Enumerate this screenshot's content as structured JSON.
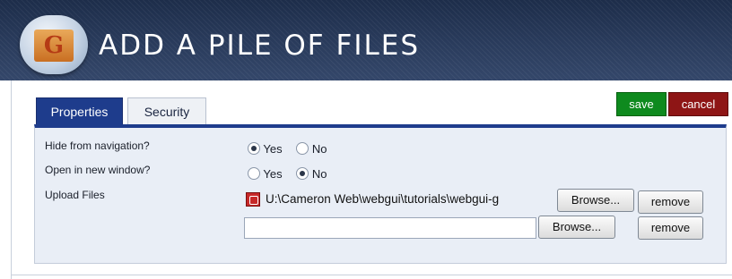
{
  "header": {
    "title": "ADD A PILE OF FILES",
    "logo_letter": "G"
  },
  "tabs": [
    {
      "label": "Properties",
      "active": true
    },
    {
      "label": "Security",
      "active": false
    }
  ],
  "actions": {
    "save_label": "save",
    "cancel_label": "cancel"
  },
  "form": {
    "hide_from_navigation": {
      "label": "Hide from navigation?",
      "yes_label": "Yes",
      "no_label": "No",
      "selected": "Yes"
    },
    "open_in_new_window": {
      "label": "Open in new window?",
      "yes_label": "Yes",
      "no_label": "No",
      "selected": "No"
    },
    "upload_files": {
      "label": "Upload Files",
      "file1_path": "U:\\Cameron Web\\webgui\\tutorials\\webgui-g",
      "browse_label": "Browse...",
      "remove_label": "remove",
      "file2_value": ""
    }
  },
  "colors": {
    "accent": "#1e3c8c",
    "save": "#0e8a1e",
    "cancel": "#8e1515",
    "panel_bg": "#e9eef6"
  }
}
